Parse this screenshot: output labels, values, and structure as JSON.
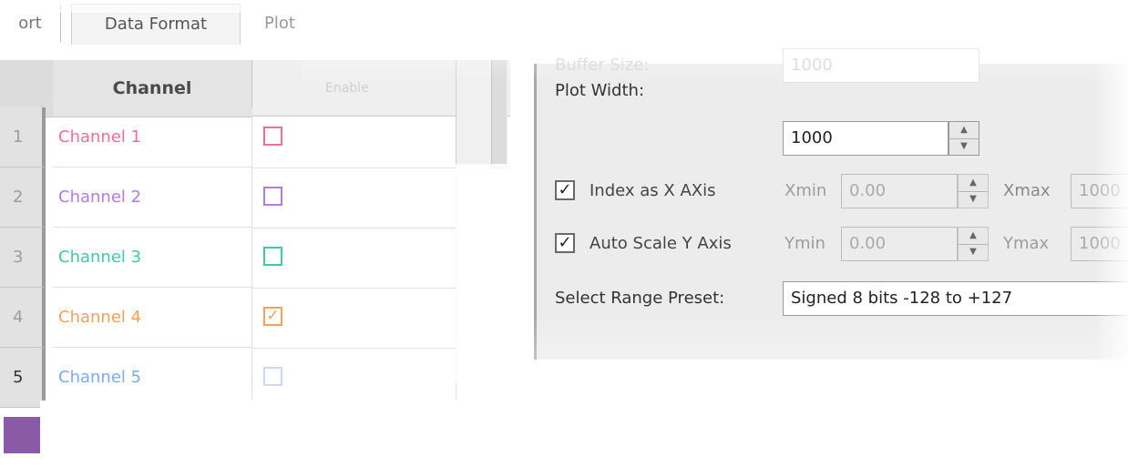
{
  "tabs": [
    "ort",
    "Data Format",
    "Plot"
  ],
  "grid": {
    "headers": {
      "channel": "Channel",
      "plot": "Enable"
    },
    "rows": [
      {
        "num": "1",
        "name": "Channel 1",
        "color": "#ee6f96",
        "checked": ""
      },
      {
        "num": "2",
        "name": "Channel 2",
        "color": "#b47ae8",
        "checked": ""
      },
      {
        "num": "3",
        "name": "Channel 3",
        "color": "#3fc9a4",
        "checked": ""
      },
      {
        "num": "4",
        "name": "Channel 4",
        "color": "#f4a25a",
        "checked": "✓"
      },
      {
        "num": "5",
        "name": "Channel 5",
        "color": "#7eaaf4",
        "checked": ""
      }
    ]
  },
  "panel": {
    "buffer_size_label": "Buffer Size:",
    "buffer_size_value": "1000",
    "plot_width_label": "Plot Width:",
    "plot_width_value": "1000",
    "index_x_label": "Index as X AXis",
    "index_x_checked": "✓",
    "xmin_label": "Xmin",
    "xmin_value": "0.00",
    "xmax_label": "Xmax",
    "xmax_value": "1000",
    "auto_scale_label": "Auto Scale Y Axis",
    "auto_scale_checked": "✓",
    "ymin_label": "Ymin",
    "ymin_value": "0.00",
    "ymax_label": "Ymax",
    "ymax_value": "1000",
    "preset_label": "Select Range Preset:",
    "preset_value": "Signed 8 bits -128 to +127"
  },
  "colors": {
    "swatch": "#8a5aa6"
  }
}
